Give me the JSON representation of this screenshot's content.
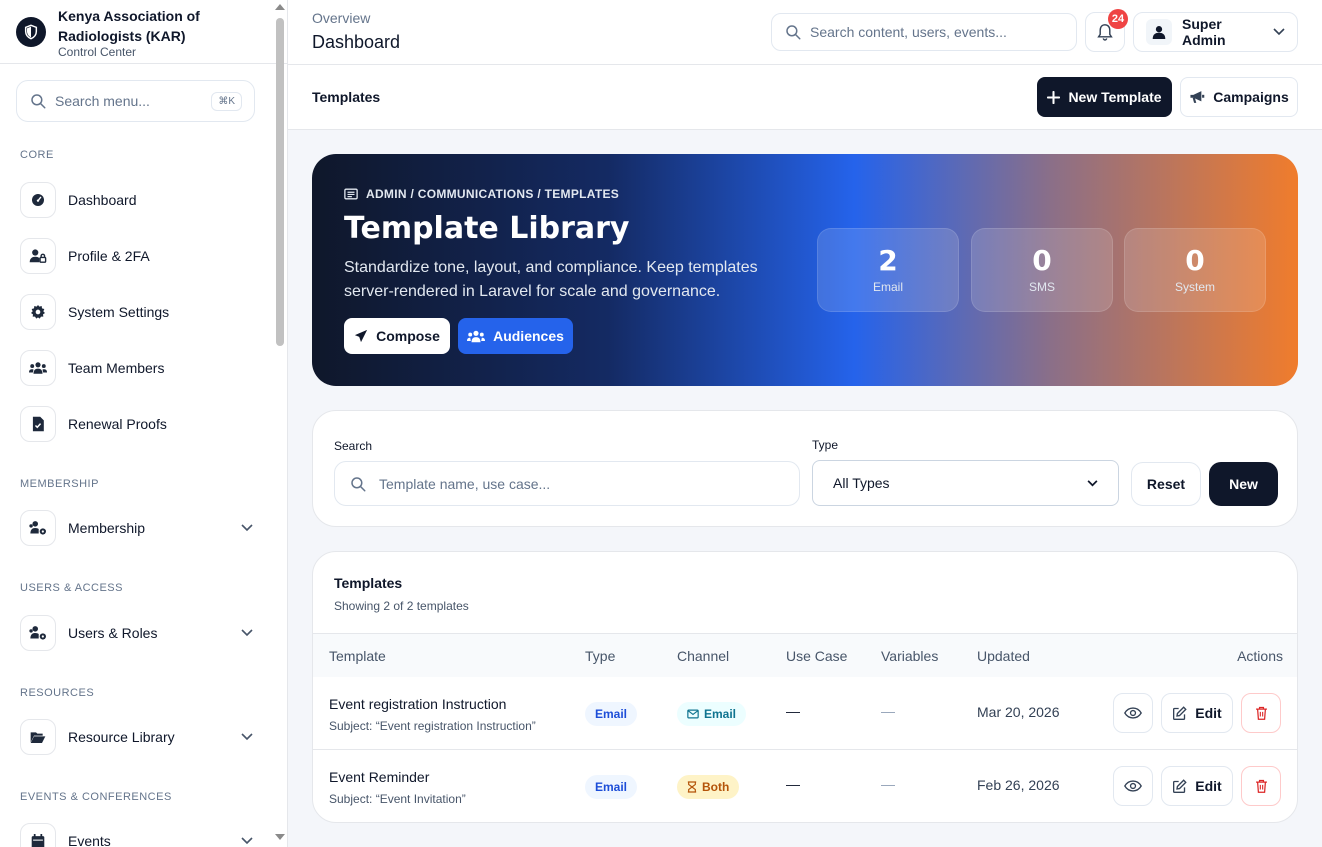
{
  "brand": {
    "name": "Kenya Association of Radiologists (KAR)",
    "subtitle": "Control Center"
  },
  "sidebar": {
    "search_placeholder": "Search menu...",
    "search_shortcut": "⌘K",
    "sections": {
      "core": "CORE",
      "membership": "MEMBERSHIP",
      "users_access": "USERS & ACCESS",
      "resources": "RESOURCES",
      "events": "EVENTS & CONFERENCES"
    },
    "items": {
      "dashboard": "Dashboard",
      "profile": "Profile & 2FA",
      "settings": "System Settings",
      "team": "Team Members",
      "renewal": "Renewal Proofs",
      "membership": "Membership",
      "users_roles": "Users & Roles",
      "resource_library": "Resource Library",
      "events": "Events"
    }
  },
  "header": {
    "breadcrumb": "Overview",
    "title": "Dashboard",
    "search_placeholder": "Search content, users, events...",
    "notification_count": "24",
    "user_name": "Super Admin"
  },
  "subheader": {
    "title": "Templates",
    "new_template": "New Template",
    "campaigns": "Campaigns"
  },
  "hero": {
    "breadcrumb": "ADMIN / COMMUNICATIONS / TEMPLATES",
    "title": "Template Library",
    "description": "Standardize tone, layout, and compliance. Keep templates server-rendered in Laravel for scale and governance.",
    "compose": "Compose",
    "audiences": "Audiences",
    "stats": [
      {
        "value": "2",
        "label": "Email"
      },
      {
        "value": "0",
        "label": "SMS"
      },
      {
        "value": "0",
        "label": "System"
      }
    ]
  },
  "filters": {
    "search_label": "Search",
    "search_placeholder": "Template name, use case...",
    "type_label": "Type",
    "type_value": "All Types",
    "reset": "Reset",
    "new": "New"
  },
  "table": {
    "title": "Templates",
    "subtitle": "Showing 2 of 2 templates",
    "columns": [
      "Template",
      "Type",
      "Channel",
      "Use Case",
      "Variables",
      "Updated",
      "Actions"
    ],
    "rows": [
      {
        "name": "Event registration Instruction",
        "subject": "Subject: “Event registration Instruction”",
        "type": "Email",
        "channel": "Email",
        "use_case": "—",
        "variables": "—",
        "updated": "Mar 20, 2026",
        "edit": "Edit"
      },
      {
        "name": "Event Reminder",
        "subject": "Subject: “Event Invitation”",
        "type": "Email",
        "channel": "Both",
        "use_case": "—",
        "variables": "—",
        "updated": "Feb 26, 2026",
        "edit": "Edit"
      }
    ]
  },
  "colors": {
    "primary_dark": "#0f172a",
    "accent_blue": "#2563eb",
    "accent_orange": "#f07c2c",
    "danger": "#ef4444"
  }
}
